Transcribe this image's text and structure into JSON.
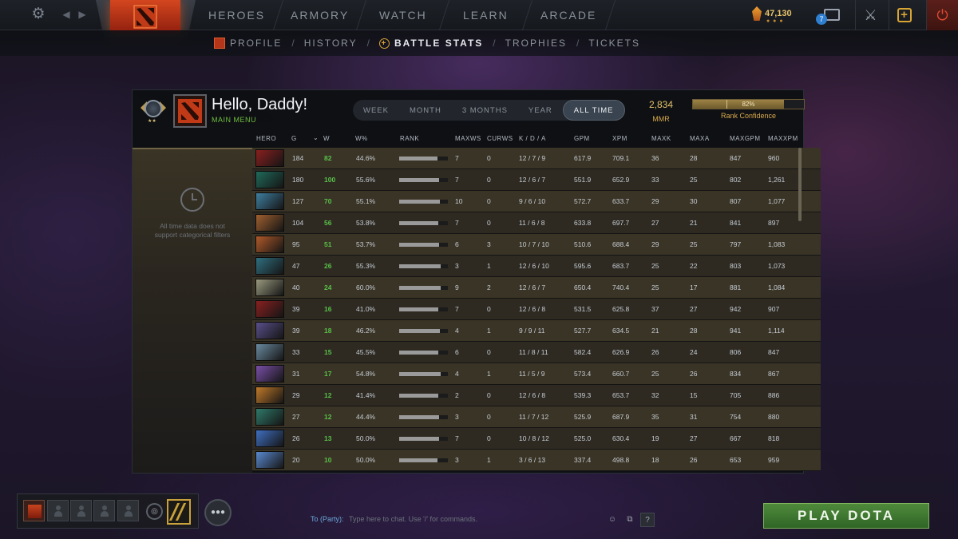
{
  "topnav": {
    "tabs": [
      "HEROES",
      "ARMORY",
      "WATCH",
      "LEARN",
      "ARCADE"
    ],
    "shards": "47,130",
    "notifications": "7"
  },
  "subnav": {
    "items": [
      "PROFILE",
      "HISTORY",
      "BATTLE STATS",
      "TROPHIES",
      "TICKETS"
    ],
    "active": "BATTLE STATS"
  },
  "profile": {
    "name": "Hello, Daddy!",
    "subtitle": "MAIN MENU",
    "mmr_value": "2,834",
    "mmr_label": "MMR",
    "confidence_value": "82%",
    "confidence_fraction": 0.82,
    "confidence_label": "Rank Confidence"
  },
  "periods": {
    "options": [
      "WEEK",
      "MONTH",
      "3 MONTHS",
      "YEAR",
      "ALL TIME"
    ],
    "active": "ALL TIME"
  },
  "table": {
    "columns": [
      "HERO",
      "G",
      "W",
      "W%",
      "RANK",
      "MAXWS",
      "CURWS",
      "K / D / A",
      "GPM",
      "XPM",
      "MAXK",
      "MAXA",
      "MAXGPM",
      "MAXXPM"
    ],
    "rows": [
      {
        "hero_color": "#8a1f1f",
        "g": "184",
        "w": "82",
        "wp": "44.6%",
        "rank": 0.78,
        "maxws": "7",
        "curws": "0",
        "kda": "12 / 7 / 9",
        "gpm": "617.9",
        "xpm": "709.1",
        "maxk": "36",
        "maxa": "28",
        "maxgpm": "847",
        "maxxpm": "960"
      },
      {
        "hero_color": "#1f6a5a",
        "g": "180",
        "w": "100",
        "wp": "55.6%",
        "rank": 0.82,
        "maxws": "7",
        "curws": "0",
        "kda": "12 / 6 / 7",
        "gpm": "551.9",
        "xpm": "652.9",
        "maxk": "33",
        "maxa": "25",
        "maxgpm": "802",
        "maxxpm": "1,261"
      },
      {
        "hero_color": "#3f7fa0",
        "g": "127",
        "w": "70",
        "wp": "55.1%",
        "rank": 0.84,
        "maxws": "10",
        "curws": "0",
        "kda": "9 / 6 / 10",
        "gpm": "572.7",
        "xpm": "633.7",
        "maxk": "29",
        "maxa": "30",
        "maxgpm": "807",
        "maxxpm": "1,077"
      },
      {
        "hero_color": "#a0602f",
        "g": "104",
        "w": "56",
        "wp": "53.8%",
        "rank": 0.8,
        "maxws": "7",
        "curws": "0",
        "kda": "11 / 6 / 8",
        "gpm": "633.8",
        "xpm": "697.7",
        "maxk": "27",
        "maxa": "21",
        "maxgpm": "841",
        "maxxpm": "897"
      },
      {
        "hero_color": "#b05a2a",
        "g": "95",
        "w": "51",
        "wp": "53.7%",
        "rank": 0.82,
        "maxws": "6",
        "curws": "3",
        "kda": "10 / 7 / 10",
        "gpm": "510.6",
        "xpm": "688.4",
        "maxk": "29",
        "maxa": "25",
        "maxgpm": "797",
        "maxxpm": "1,083"
      },
      {
        "hero_color": "#2f6f80",
        "g": "47",
        "w": "26",
        "wp": "55.3%",
        "rank": 0.85,
        "maxws": "3",
        "curws": "1",
        "kda": "12 / 6 / 10",
        "gpm": "595.6",
        "xpm": "683.7",
        "maxk": "25",
        "maxa": "22",
        "maxgpm": "803",
        "maxxpm": "1,073"
      },
      {
        "hero_color": "#9a9a80",
        "g": "40",
        "w": "24",
        "wp": "60.0%",
        "rank": 0.86,
        "maxws": "9",
        "curws": "2",
        "kda": "12 / 6 / 7",
        "gpm": "650.4",
        "xpm": "740.4",
        "maxk": "25",
        "maxa": "17",
        "maxgpm": "881",
        "maxxpm": "1,084"
      },
      {
        "hero_color": "#8a2020",
        "g": "39",
        "w": "16",
        "wp": "41.0%",
        "rank": 0.8,
        "maxws": "7",
        "curws": "0",
        "kda": "12 / 6 / 8",
        "gpm": "531.5",
        "xpm": "625.8",
        "maxk": "37",
        "maxa": "27",
        "maxgpm": "942",
        "maxxpm": "907"
      },
      {
        "hero_color": "#5a4f8a",
        "g": "39",
        "w": "18",
        "wp": "46.2%",
        "rank": 0.84,
        "maxws": "4",
        "curws": "1",
        "kda": "9 / 9 / 11",
        "gpm": "527.7",
        "xpm": "634.5",
        "maxk": "21",
        "maxa": "28",
        "maxgpm": "941",
        "maxxpm": "1,114"
      },
      {
        "hero_color": "#6a8aa0",
        "g": "33",
        "w": "15",
        "wp": "45.5%",
        "rank": 0.8,
        "maxws": "6",
        "curws": "0",
        "kda": "11 / 8 / 11",
        "gpm": "582.4",
        "xpm": "626.9",
        "maxk": "26",
        "maxa": "24",
        "maxgpm": "806",
        "maxxpm": "847"
      },
      {
        "hero_color": "#7a4fa8",
        "g": "31",
        "w": "17",
        "wp": "54.8%",
        "rank": 0.85,
        "maxws": "4",
        "curws": "1",
        "kda": "11 / 5 / 9",
        "gpm": "573.4",
        "xpm": "660.7",
        "maxk": "25",
        "maxa": "26",
        "maxgpm": "834",
        "maxxpm": "867"
      },
      {
        "hero_color": "#c07a2a",
        "g": "29",
        "w": "12",
        "wp": "41.4%",
        "rank": 0.8,
        "maxws": "2",
        "curws": "0",
        "kda": "12 / 6 / 8",
        "gpm": "539.3",
        "xpm": "653.7",
        "maxk": "32",
        "maxa": "15",
        "maxgpm": "705",
        "maxxpm": "886"
      },
      {
        "hero_color": "#2f7a6a",
        "g": "27",
        "w": "12",
        "wp": "44.4%",
        "rank": 0.82,
        "maxws": "3",
        "curws": "0",
        "kda": "11 / 7 / 12",
        "gpm": "525.9",
        "xpm": "687.9",
        "maxk": "35",
        "maxa": "31",
        "maxgpm": "754",
        "maxxpm": "880"
      },
      {
        "hero_color": "#3f6fc0",
        "g": "26",
        "w": "13",
        "wp": "50.0%",
        "rank": 0.82,
        "maxws": "7",
        "curws": "0",
        "kda": "10 / 8 / 12",
        "gpm": "525.0",
        "xpm": "630.4",
        "maxk": "19",
        "maxa": "27",
        "maxgpm": "667",
        "maxxpm": "818"
      },
      {
        "hero_color": "#5a8ad0",
        "g": "20",
        "w": "10",
        "wp": "50.0%",
        "rank": 0.78,
        "maxws": "3",
        "curws": "1",
        "kda": "3 / 6 / 13",
        "gpm": "337.4",
        "xpm": "498.8",
        "maxk": "18",
        "maxa": "26",
        "maxgpm": "653",
        "maxxpm": "959"
      }
    ]
  },
  "sidebar": {
    "message": "All time data does not support categorical filters"
  },
  "chat": {
    "to_label": "To (Party):",
    "placeholder": "Type here to chat. Use '/' for commands."
  },
  "play_button": "PLAY DOTA"
}
